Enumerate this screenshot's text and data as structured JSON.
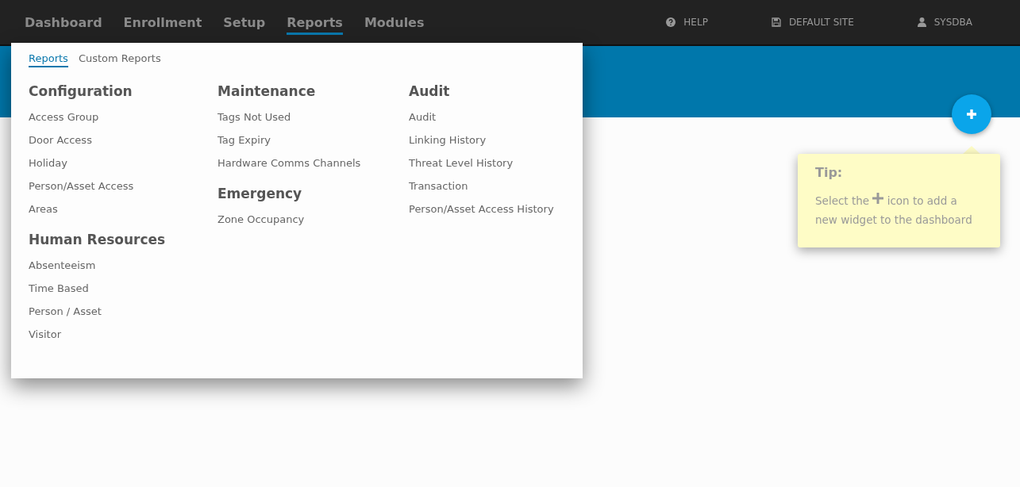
{
  "nav": {
    "items": [
      {
        "label": "Dashboard",
        "selected": false
      },
      {
        "label": "Enrollment",
        "selected": false
      },
      {
        "label": "Setup",
        "selected": false
      },
      {
        "label": "Reports",
        "selected": true
      },
      {
        "label": "Modules",
        "selected": false
      }
    ],
    "right": [
      {
        "kind": "help",
        "label": "HELP"
      },
      {
        "kind": "site",
        "label": "DEFAULT SITE"
      },
      {
        "kind": "user",
        "label": "SYSDBA"
      }
    ]
  },
  "menu": {
    "tabs": [
      {
        "label": "Reports",
        "selected": true
      },
      {
        "label": "Custom Reports",
        "selected": false
      }
    ],
    "columns": [
      [
        {
          "title": "Configuration",
          "items": [
            "Access Group",
            "Door Access",
            "Holiday",
            "Person/Asset Access",
            "Areas"
          ]
        },
        {
          "title": "Human Resources",
          "items": [
            "Absenteeism",
            "Time Based",
            "Person / Asset",
            "Visitor"
          ]
        }
      ],
      [
        {
          "title": "Maintenance",
          "items": [
            "Tags Not Used",
            "Tag Expiry",
            "Hardware Comms Channels"
          ]
        },
        {
          "title": "Emergency",
          "items": [
            "Zone Occupancy"
          ]
        }
      ],
      [
        {
          "title": "Audit",
          "items": [
            "Audit",
            "Linking History",
            "Threat Level History",
            "Transaction",
            "Person/Asset Access History"
          ]
        }
      ]
    ]
  },
  "tip": {
    "title": "Tip:",
    "before": "Select the",
    "after": "icon to add a",
    "line2": "new widget to the dashboard"
  }
}
